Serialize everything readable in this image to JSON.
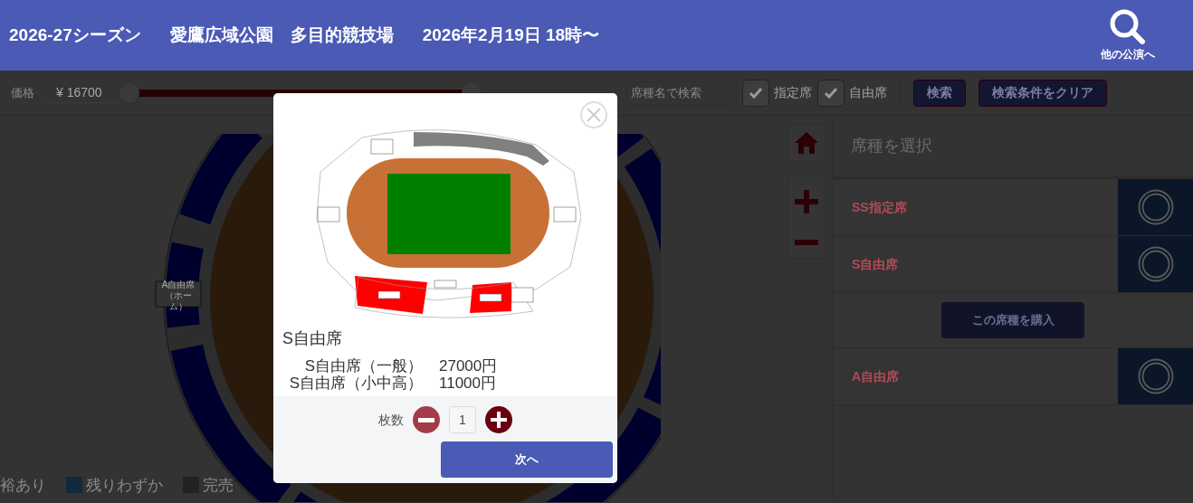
{
  "header": {
    "season": "2026-27シーズン",
    "venue": "愛鷹広域公園　多目的競技場",
    "date": "2026年2月19日 18時〜",
    "other_link": "他の公演へ"
  },
  "filter": {
    "price_label": "価格",
    "price_min": "¥ 16700",
    "search_placeholder": "席種名で検索",
    "checks": [
      {
        "label": "指定席",
        "checked": true
      },
      {
        "label": "自由席",
        "checked": true
      }
    ],
    "buttons": [
      "検索",
      "検索条件をクリア"
    ]
  },
  "map": {
    "labels": [
      "A自由席（ホーム）"
    ]
  },
  "legend": [
    {
      "label": "裕あり"
    },
    {
      "label": "残りわずか",
      "color": "#0f2a3a"
    },
    {
      "label": "完売",
      "color": "#222222"
    }
  ],
  "panel": {
    "title": "席種を選択",
    "rows": [
      {
        "kind": "seat",
        "name": "SS指定席"
      },
      {
        "kind": "seat",
        "name": "S自由席"
      },
      {
        "kind": "buy",
        "label": "この席種を購入"
      },
      {
        "kind": "seat",
        "name": "A自由席"
      }
    ]
  },
  "modal": {
    "title": "S自由席",
    "prices": [
      {
        "name": "S自由席（一般）",
        "price": "27000円"
      },
      {
        "name": "S自由席（小中高）",
        "price": "11000円"
      }
    ],
    "quantity_label": "枚数",
    "quantity": "1",
    "next_button": "次へ"
  }
}
